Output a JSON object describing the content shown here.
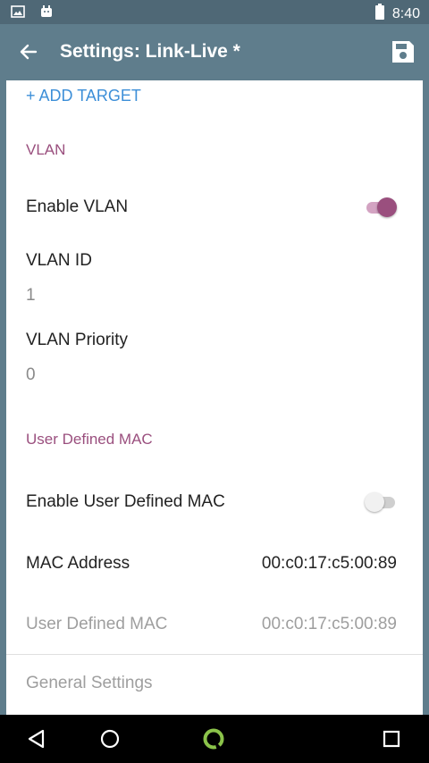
{
  "status_bar": {
    "time": "8:40",
    "left_icons": [
      "image-icon",
      "android-icon"
    ],
    "right_icons": [
      "battery-icon"
    ]
  },
  "app_bar": {
    "title": "Settings: Link-Live *",
    "back_icon": "arrow-back-icon",
    "save_icon": "save-icon"
  },
  "add_target": {
    "label": "+ ADD TARGET"
  },
  "vlan": {
    "header": "VLAN",
    "enable_label": "Enable VLAN",
    "enable_state": true,
    "id_label": "VLAN ID",
    "id_value": "1",
    "priority_label": "VLAN Priority",
    "priority_value": "0"
  },
  "mac": {
    "header": "User Defined MAC",
    "enable_label": "Enable User Defined MAC",
    "enable_state": false,
    "address_label": "MAC Address",
    "address_value": "00:c0:17:c5:00:89",
    "user_label": "User Defined MAC",
    "user_value": "00:c0:17:c5:00:89"
  },
  "general": {
    "label": "General Settings"
  },
  "nav_bar": {
    "icons": [
      "back-triangle-icon",
      "home-circle-icon",
      "app-ring-icon",
      "recents-square-icon"
    ]
  },
  "colors": {
    "app_bar": "#5f7d8c",
    "accent": "#9a4f7e",
    "link": "#3d8fd8"
  }
}
